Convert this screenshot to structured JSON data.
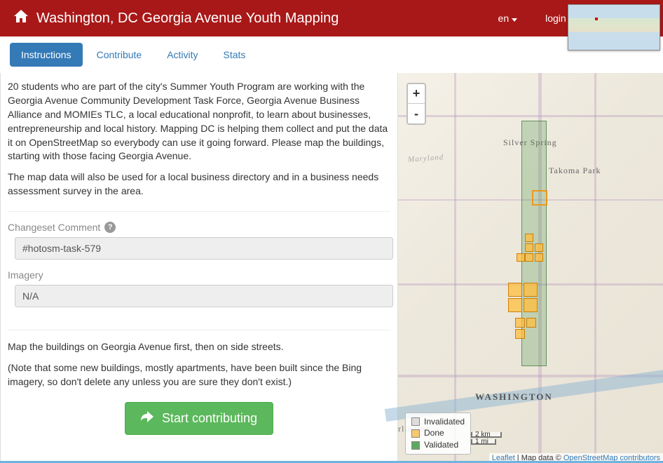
{
  "header": {
    "title": "Washington, DC Georgia Avenue Youth Mapping",
    "lang": "en",
    "login": "login to OpenStreetMap"
  },
  "tabs": {
    "instructions": "Instructions",
    "contribute": "Contribute",
    "activity": "Activity",
    "stats": "Stats"
  },
  "instructions": {
    "p1": "20 students who are part of the city's Summer Youth Program are working with the Georgia Avenue Community Development Task Force, Georgia Avenue Business Alliance and MOMIEs TLC, a local educational nonprofit, to learn about businesses, entrepreneurship and local history. Mapping DC is helping them collect and put the data it on OpenStreetMap so everybody can use it going forward. Please map the buildings, starting with those facing Georgia Avenue.",
    "p2": "The map data will also be used for a local business directory and in a business needs assessment survey in the area.",
    "changeset_label": "Changeset Comment",
    "changeset_value": "#hotosm-task-579",
    "imagery_label": "Imagery",
    "imagery_value": "N/A",
    "p3": "Map the buildings on Georgia Avenue first, then on side streets.",
    "p4": "(Note that some new buildings, mostly apartments, have been built since the Bing imagery, so don't delete any unless you are sure they don't exist.)",
    "start_button": "Start contributing"
  },
  "map": {
    "zoom_in": "+",
    "zoom_out": "-",
    "labels": {
      "washington": "WASHINGTON",
      "silver_spring": "Silver Spring",
      "takoma_park": "Takoma Park",
      "arlington": "rlington",
      "maryland": "Maryland"
    },
    "legend": {
      "invalidated": "Invalidated",
      "done": "Done",
      "validated": "Validated"
    },
    "scale": {
      "km": "2 km",
      "mi": "1 mi"
    },
    "attribution": {
      "leaflet": "Leaflet",
      "sep": " | Map data © ",
      "osm": "OpenStreetMap contributors"
    }
  }
}
